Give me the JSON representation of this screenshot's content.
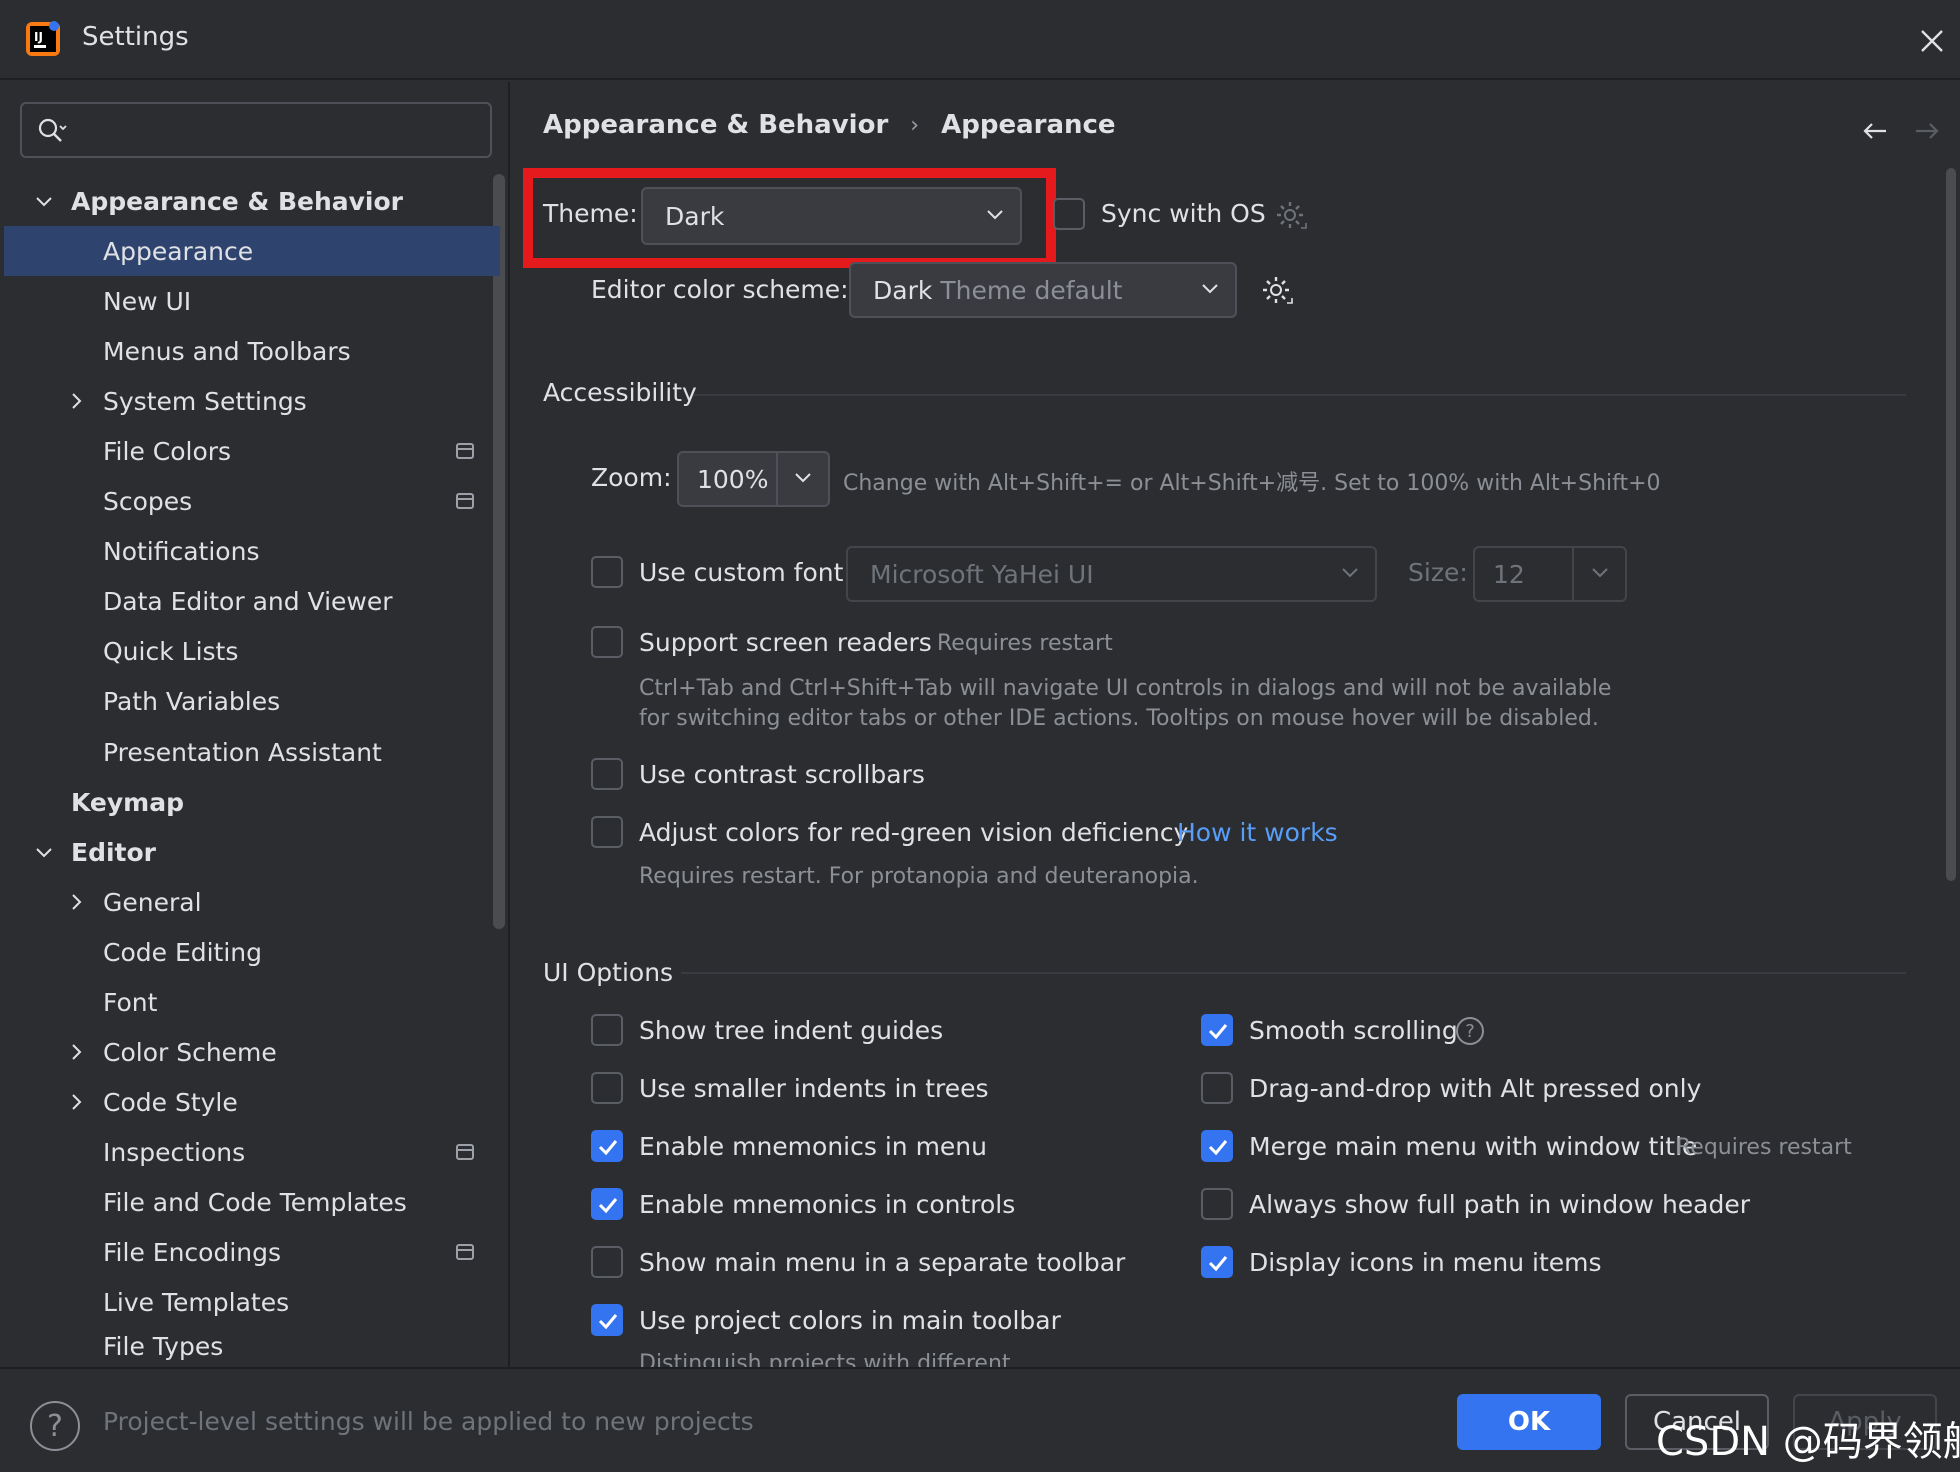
{
  "window": {
    "title": "Settings"
  },
  "search": {
    "placeholder": ""
  },
  "sidebar": {
    "items": [
      {
        "label": "Appearance & Behavior"
      },
      {
        "label": "Appearance"
      },
      {
        "label": "New UI"
      },
      {
        "label": "Menus and Toolbars"
      },
      {
        "label": "System Settings"
      },
      {
        "label": "File Colors"
      },
      {
        "label": "Scopes"
      },
      {
        "label": "Notifications"
      },
      {
        "label": "Data Editor and Viewer"
      },
      {
        "label": "Quick Lists"
      },
      {
        "label": "Path Variables"
      },
      {
        "label": "Presentation Assistant"
      },
      {
        "label": "Keymap"
      },
      {
        "label": "Editor"
      },
      {
        "label": "General"
      },
      {
        "label": "Code Editing"
      },
      {
        "label": "Font"
      },
      {
        "label": "Color Scheme"
      },
      {
        "label": "Code Style"
      },
      {
        "label": "Inspections"
      },
      {
        "label": "File and Code Templates"
      },
      {
        "label": "File Encodings"
      },
      {
        "label": "Live Templates"
      },
      {
        "label": "File Types"
      }
    ]
  },
  "breadcrumb": {
    "parent": "Appearance & Behavior",
    "separator": "›",
    "current": "Appearance"
  },
  "theme": {
    "label": "Theme:",
    "value": "Dark",
    "sync_label": "Sync with OS",
    "sync_checked": false
  },
  "editor_scheme": {
    "label": "Editor color scheme:",
    "value_main": "Dark",
    "value_sub": "Theme default"
  },
  "accessibility": {
    "title": "Accessibility",
    "zoom_label": "Zoom:",
    "zoom_value": "100%",
    "zoom_hint": "Change with Alt+Shift+= or Alt+Shift+减号. Set to 100% with Alt+Shift+0",
    "custom_font_label": "Use custom font:",
    "custom_font_value": "Microsoft YaHei UI",
    "size_label": "Size:",
    "size_value": "12",
    "screen_readers_label": "Support screen readers",
    "screen_readers_hint": "Requires restart",
    "screen_readers_desc1": "Ctrl+Tab and Ctrl+Shift+Tab will navigate UI controls in dialogs and will not be available",
    "screen_readers_desc2": "for switching editor tabs or other IDE actions. Tooltips on mouse hover will be disabled.",
    "contrast_label": "Use contrast scrollbars",
    "red_green_label": "Adjust colors for red-green vision deficiency",
    "how_it_works": "How it works",
    "red_green_desc": "Requires restart. For protanopia and deuteranopia."
  },
  "ui_options": {
    "title": "UI Options",
    "left": [
      {
        "label": "Show tree indent guides",
        "checked": false
      },
      {
        "label": "Use smaller indents in trees",
        "checked": false
      },
      {
        "label": "Enable mnemonics in menu",
        "checked": true
      },
      {
        "label": "Enable mnemonics in controls",
        "checked": true
      },
      {
        "label": "Show main menu in a separate toolbar",
        "checked": false
      },
      {
        "label": "Use project colors in main toolbar",
        "checked": true
      }
    ],
    "right": [
      {
        "label": "Smooth scrolling",
        "checked": true
      },
      {
        "label": "Drag-and-drop with Alt pressed only",
        "checked": false
      },
      {
        "label": "Merge main menu with window title",
        "checked": true,
        "hint": "Requires restart"
      },
      {
        "label": "Always show full path in window header",
        "checked": false
      },
      {
        "label": "Display icons in menu items",
        "checked": true
      }
    ],
    "cut_off_text": "Distinguish projects with different"
  },
  "footer": {
    "help": "?",
    "note": "Project-level settings will be applied to new projects",
    "ok": "OK",
    "cancel": "Cancel",
    "apply": "Apply",
    "watermark": "CSDN @码界领航"
  },
  "colors": {
    "background": "#2b2d30",
    "selection": "#2e436e",
    "accent": "#3574f0",
    "highlight_box": "#e41a1c",
    "link": "#589df6"
  }
}
